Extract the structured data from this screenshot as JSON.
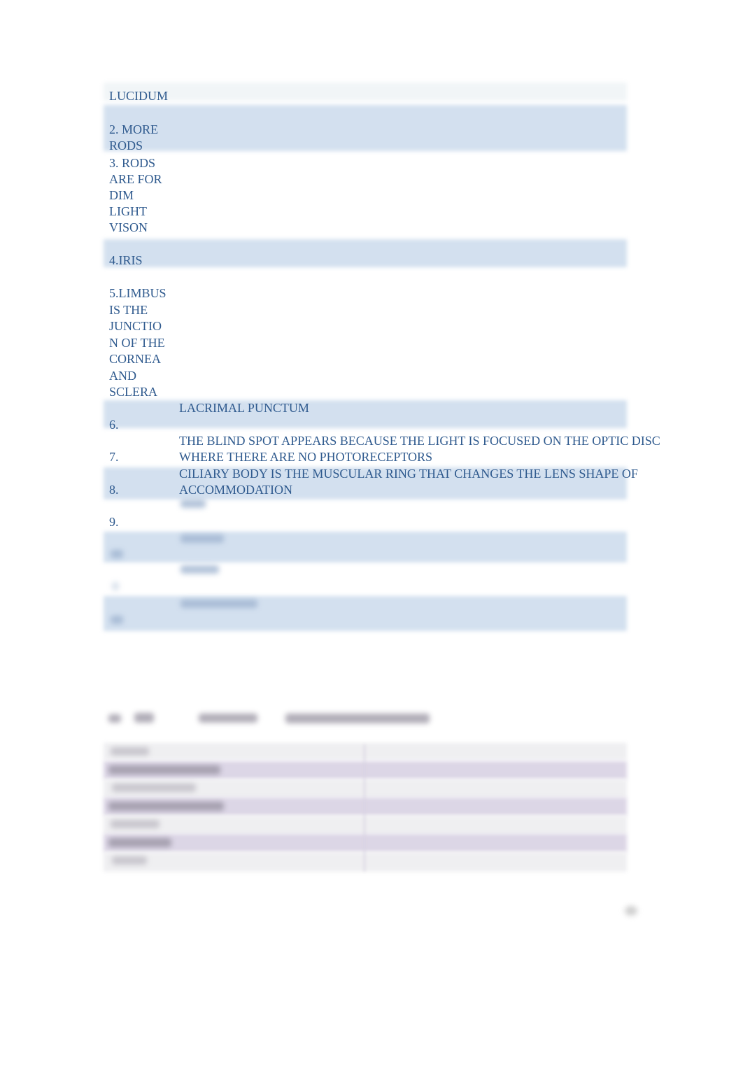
{
  "table1": {
    "rows": [
      {
        "col1": "LUCIDUM",
        "col2": ""
      },
      {
        "col1": "2. MORE\nRODS",
        "col2": ""
      },
      {
        "col1": "3. RODS\nARE FOR\nDIM\nLIGHT\nVISON",
        "col2": ""
      },
      {
        "col1": "4.IRIS",
        "col2": ""
      },
      {
        "col1": "5.LIMBUS\nIS THE\nJUNCTIO\nN OF THE\nCORNEA\nAND\nSCLERA",
        "col2": ""
      },
      {
        "col1": "6.",
        "col2": "LACRIMAL PUNCTUM"
      },
      {
        "col1": "7.",
        "col2": "THE BLIND SPOT APPEARS BECAUSE THE LIGHT IS FOCUSED ON THE OPTIC DISC\nWHERE THERE ARE NO PHOTORECEPTORS"
      },
      {
        "col1": "8.",
        "col2": "CILIARY BODY IS THE MUSCULAR RING THAT CHANGES THE LENS SHAPE OF\nACCOMMODATION"
      },
      {
        "col1": "9.",
        "col2": "[blurred]"
      },
      {
        "col1": "[blurred]",
        "col2": "[blurred]"
      },
      {
        "col1": "[blurred]",
        "col2": "[blurred]"
      },
      {
        "col1": "[blurred]",
        "col2": "[blurred]"
      }
    ]
  },
  "section2": {
    "heading": "[blurred]",
    "rows_count_visible": 7,
    "content": "[blurred]"
  },
  "page_number": "[blurred]"
}
